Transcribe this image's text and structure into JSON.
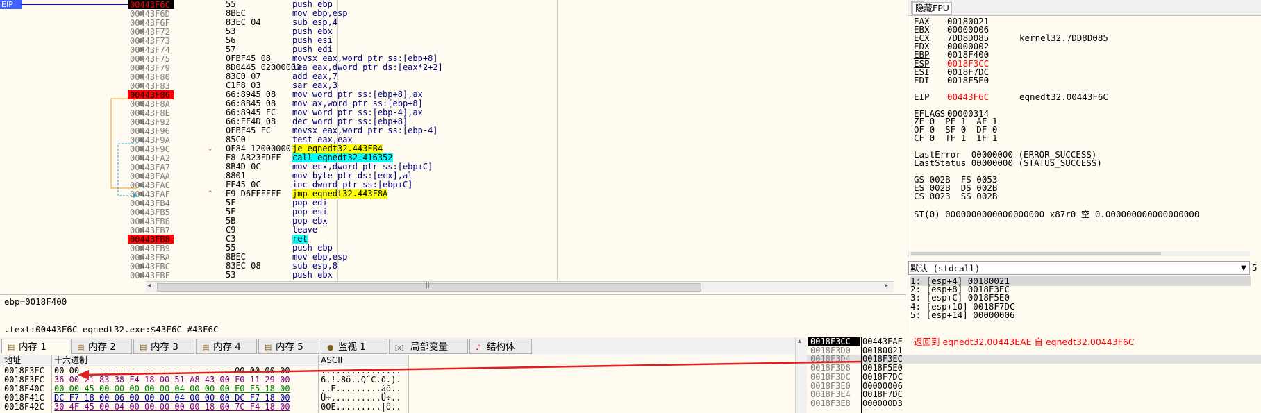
{
  "disasm": {
    "eip_label": "EIP",
    "lines": [
      {
        "addr": "00443F6C",
        "bytes": "55",
        "instr": "push ebp",
        "state": "cur"
      },
      {
        "addr": "00443F6D",
        "bytes": "8BEC",
        "instr": "mov ebp,esp",
        "state": ""
      },
      {
        "addr": "00443F6F",
        "bytes": "83EC 04",
        "instr": "sub esp,4",
        "state": ""
      },
      {
        "addr": "00443F72",
        "bytes": "53",
        "instr": "push ebx",
        "state": ""
      },
      {
        "addr": "00443F73",
        "bytes": "56",
        "instr": "push esi",
        "state": ""
      },
      {
        "addr": "00443F74",
        "bytes": "57",
        "instr": "push edi",
        "state": ""
      },
      {
        "addr": "00443F75",
        "bytes": "0FBF45 08",
        "instr": "movsx eax,word ptr ss:[ebp+8]",
        "state": ""
      },
      {
        "addr": "00443F79",
        "bytes": "8D0445 02000000",
        "instr": "lea eax,dword ptr ds:[eax*2+2]",
        "state": ""
      },
      {
        "addr": "00443F80",
        "bytes": "83C0 07",
        "instr": "add eax,7",
        "state": ""
      },
      {
        "addr": "00443F83",
        "bytes": "C1F8 03",
        "instr": "sar eax,3",
        "state": ""
      },
      {
        "addr": "00443F86",
        "bytes": "66:8945 08",
        "instr": "mov word ptr ss:[ebp+8],ax",
        "state": "bp"
      },
      {
        "addr": "00443F8A",
        "bytes": "66:8B45 08",
        "instr": "mov ax,word ptr ss:[ebp+8]",
        "state": ""
      },
      {
        "addr": "00443F8E",
        "bytes": "66:8945 FC",
        "instr": "mov word ptr ss:[ebp-4],ax",
        "state": ""
      },
      {
        "addr": "00443F92",
        "bytes": "66:FF4D 08",
        "instr": "dec word ptr ss:[ebp+8]",
        "state": ""
      },
      {
        "addr": "00443F96",
        "bytes": "0FBF45 FC",
        "instr": "movsx eax,word ptr ss:[ebp-4]",
        "state": ""
      },
      {
        "addr": "00443F9A",
        "bytes": "85C0",
        "instr": "test eax,eax",
        "state": ""
      },
      {
        "addr": "00443F9C",
        "bytes": "0F84 12000000",
        "instr": "je eqnedt32.443FB4",
        "state": "",
        "jump": "v",
        "hl": "y"
      },
      {
        "addr": "00443FA2",
        "bytes": "E8 AB23FDFF",
        "instr": "call eqnedt32.416352",
        "state": "",
        "hl": "call"
      },
      {
        "addr": "00443FA7",
        "bytes": "8B4D 0C",
        "instr": "mov ecx,dword ptr ss:[ebp+C]",
        "state": ""
      },
      {
        "addr": "00443FAA",
        "bytes": "8801",
        "instr": "mov byte ptr ds:[ecx],al",
        "state": ""
      },
      {
        "addr": "00443FAC",
        "bytes": "FF45 0C",
        "instr": "inc dword ptr ss:[ebp+C]",
        "state": ""
      },
      {
        "addr": "00443FAF",
        "bytes": "E9 D6FFFFFF",
        "instr": "jmp eqnedt32.443F8A",
        "state": "",
        "jump": "^",
        "hl": "y"
      },
      {
        "addr": "00443FB4",
        "bytes": "5F",
        "instr": "pop edi",
        "state": ""
      },
      {
        "addr": "00443FB5",
        "bytes": "5E",
        "instr": "pop esi",
        "state": ""
      },
      {
        "addr": "00443FB6",
        "bytes": "5B",
        "instr": "pop ebx",
        "state": ""
      },
      {
        "addr": "00443FB7",
        "bytes": "C9",
        "instr": "leave",
        "state": ""
      },
      {
        "addr": "00443FB8",
        "bytes": "C3",
        "instr": "ret",
        "state": "bp",
        "hl": "ret"
      },
      {
        "addr": "00443FB9",
        "bytes": "55",
        "instr": "push ebp",
        "state": ""
      },
      {
        "addr": "00443FBA",
        "bytes": "8BEC",
        "instr": "mov ebp,esp",
        "state": ""
      },
      {
        "addr": "00443FBC",
        "bytes": "83EC 08",
        "instr": "sub esp,8",
        "state": ""
      },
      {
        "addr": "00443FBF",
        "bytes": "53",
        "instr": "push ebx",
        "state": ""
      }
    ],
    "hscroll_grip": "|||"
  },
  "info": {
    "line1": "ebp=0018F400",
    "line2": ".text:00443F6C eqnedt32.exe:$43F6C #43F6C"
  },
  "regs": {
    "header": "隐藏FPU",
    "lines": [
      {
        "n": "EAX",
        "v": "00180021",
        "c": ""
      },
      {
        "n": "EBX",
        "v": "00000006",
        "c": ""
      },
      {
        "n": "ECX",
        "v": "7DD8D085",
        "c": "kernel32.7DD8D085"
      },
      {
        "n": "EDX",
        "v": "00000002",
        "c": ""
      },
      {
        "n": "EBP",
        "v": "0018F400",
        "c": "",
        "u": true
      },
      {
        "n": "ESP",
        "v": "0018F3CC",
        "c": "",
        "u": true,
        "red": true
      },
      {
        "n": "ESI",
        "v": "0018F7DC",
        "c": ""
      },
      {
        "n": "EDI",
        "v": "0018F5E0",
        "c": ""
      },
      {
        "n": "",
        "v": "",
        "c": ""
      },
      {
        "n": "EIP",
        "v": "00443F6C",
        "c": "eqnedt32.00443F6C",
        "red": true
      },
      {
        "n": "",
        "v": "",
        "c": ""
      },
      {
        "n": "EFLAGS",
        "v": "00000314",
        "c": ""
      }
    ],
    "flags": [
      "ZF 0  PF 1  AF 1",
      "OF 0  SF 0  DF 0",
      "CF 0  TF 1  IF 1"
    ],
    "last_error": "LastError  00000000 (ERROR_SUCCESS)",
    "last_status": "LastStatus 00000000 (STATUS_SUCCESS)",
    "segs": [
      "GS 002B  FS 0053",
      "ES 002B  DS 002B",
      "CS 0023  SS 002B"
    ],
    "st0": "ST(0) 0000000000000000000 x87r0 空 0.000000000000000000"
  },
  "args": {
    "convention": "默认 (stdcall)",
    "count": "5",
    "lines": [
      "1: [esp+4] 00180021",
      "2: [esp+8] 0018F3EC",
      "3: [esp+C] 0018F5E0",
      "4: [esp+10] 0018F7DC",
      "5: [esp+14] 00000006"
    ]
  },
  "tabs": [
    {
      "label": "内存 1",
      "icon": "dump-icon",
      "active": true
    },
    {
      "label": "内存 2",
      "icon": "dump-icon"
    },
    {
      "label": "内存 3",
      "icon": "dump-icon"
    },
    {
      "label": "内存 4",
      "icon": "dump-icon"
    },
    {
      "label": "内存 5",
      "icon": "dump-icon"
    },
    {
      "label": "监视 1",
      "icon": "watch-icon"
    },
    {
      "label": "局部变量",
      "icon": "locals-icon"
    },
    {
      "label": "结构体",
      "icon": "struct-icon"
    }
  ],
  "dump": {
    "col_addr": "地址",
    "col_hex": "十六进制",
    "col_ascii": "ASCII",
    "rows": [
      {
        "a": "0018F3EC",
        "h": "00 00 -- -- -- -- -- -- -- -- -- -- 00 00 00 00",
        "s": "................"
      },
      {
        "a": "0018F3FC",
        "h": "36 00 21 83 38 F4 18 00 51 A8 43 00 F0 11 29 00",
        "s": "6.!.8ô..Q¨C.ð.)."
      },
      {
        "a": "0018F40C",
        "h": "00 00 45 00 00 00 00 00 04 00 00 00 E0 F5 18 00",
        "s": "..E.........àõ.."
      },
      {
        "a": "0018F41C",
        "h": "DC F7 18 00 06 00 00 00 04 00 00 00 DC F7 18 00",
        "s": "Ü÷..........Ü÷.."
      },
      {
        "a": "0018F42C",
        "h": "30 4F 45 00 04 00 00 00 00 00 18 00 7C F4 18 00",
        "s": "0OE.........|ô.."
      }
    ]
  },
  "stack": {
    "rows": [
      {
        "a": "0018F3CC",
        "v": "00443EAE",
        "c": "返回到 eqnedt32.00443EAE 自 eqnedt32.00443F6C",
        "cur": true
      },
      {
        "a": "0018F3D0",
        "v": "00180021",
        "c": ""
      },
      {
        "a": "0018F3D4",
        "v": "0018F3EC",
        "c": "",
        "sel": true
      },
      {
        "a": "0018F3D8",
        "v": "0018F5E0",
        "c": ""
      },
      {
        "a": "0018F3DC",
        "v": "0018F7DC",
        "c": ""
      },
      {
        "a": "0018F3E0",
        "v": "00000006",
        "c": ""
      },
      {
        "a": "0018F3E4",
        "v": "0018F7DC",
        "c": ""
      },
      {
        "a": "0018F3E8",
        "v": "000000D3",
        "c": ""
      }
    ]
  },
  "colors": {
    "breakpoint": "#ff0000",
    "highlight": "#ffff00",
    "bracket": "#00ffff",
    "arrow": "#e02020",
    "eip_arrow": "#0000ff"
  }
}
